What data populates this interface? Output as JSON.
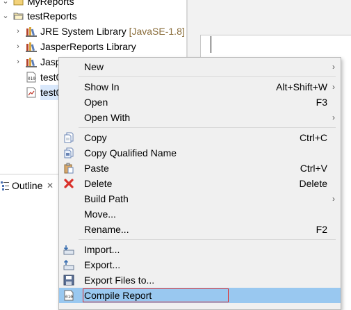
{
  "tree": {
    "items": [
      {
        "label": "MyReports",
        "hint": "",
        "twisty": "chevron-down",
        "icon": "project-folder-icon"
      },
      {
        "label": "testReports",
        "hint": "",
        "twisty": "chevron-down",
        "icon": "project-folder-icon"
      },
      {
        "label": "JRE System Library ",
        "hint": "[JavaSE-1.8]",
        "twisty": "chevron-right",
        "icon": "library-icon"
      },
      {
        "label": "JasperReports Library",
        "hint": "",
        "twisty": "chevron-right",
        "icon": "library-icon"
      },
      {
        "label": "Jasp",
        "hint": "",
        "twisty": "chevron-right",
        "icon": "library-icon"
      },
      {
        "label": "test0",
        "hint": "",
        "twisty": "",
        "icon": "binary-file-icon"
      },
      {
        "label": "test0",
        "hint": "",
        "twisty": "",
        "icon": "jrxml-file-icon"
      }
    ]
  },
  "outline": {
    "label": "Outline",
    "close": "✕"
  },
  "menu": {
    "items": [
      {
        "label": "New",
        "accel": "",
        "submenu": true,
        "icon": ""
      },
      {
        "label": "Show In",
        "accel": "Alt+Shift+W",
        "submenu": true,
        "icon": ""
      },
      {
        "label": "Open",
        "accel": "F3",
        "submenu": false,
        "icon": ""
      },
      {
        "label": "Open With",
        "accel": "",
        "submenu": true,
        "icon": ""
      },
      {
        "label": "Copy",
        "accel": "Ctrl+C",
        "submenu": false,
        "icon": "copy-icon"
      },
      {
        "label": "Copy Qualified Name",
        "accel": "",
        "submenu": false,
        "icon": "copy-qualified-name-icon"
      },
      {
        "label": "Paste",
        "accel": "Ctrl+V",
        "submenu": false,
        "icon": "paste-icon"
      },
      {
        "label": "Delete",
        "accel": "Delete",
        "submenu": false,
        "icon": "delete-icon"
      },
      {
        "label": "Build Path",
        "accel": "",
        "submenu": true,
        "icon": ""
      },
      {
        "label": "Move...",
        "accel": "",
        "submenu": false,
        "icon": ""
      },
      {
        "label": "Rename...",
        "accel": "F2",
        "submenu": false,
        "icon": ""
      },
      {
        "label": "Import...",
        "accel": "",
        "submenu": false,
        "icon": "import-icon"
      },
      {
        "label": "Export...",
        "accel": "",
        "submenu": false,
        "icon": "export-icon"
      },
      {
        "label": "Export Files to...",
        "accel": "",
        "submenu": false,
        "icon": "save-icon"
      },
      {
        "label": "Compile Report",
        "accel": "",
        "submenu": false,
        "icon": "compile-report-icon"
      }
    ],
    "highlighted": "Compile Report"
  },
  "colors": {
    "menu_bg": "#f0f0f0",
    "highlight_bg": "#99c8f0",
    "annotation_box": "#e03030",
    "path_hint": "#8a6d3b",
    "delete_red": "#d9302a"
  }
}
